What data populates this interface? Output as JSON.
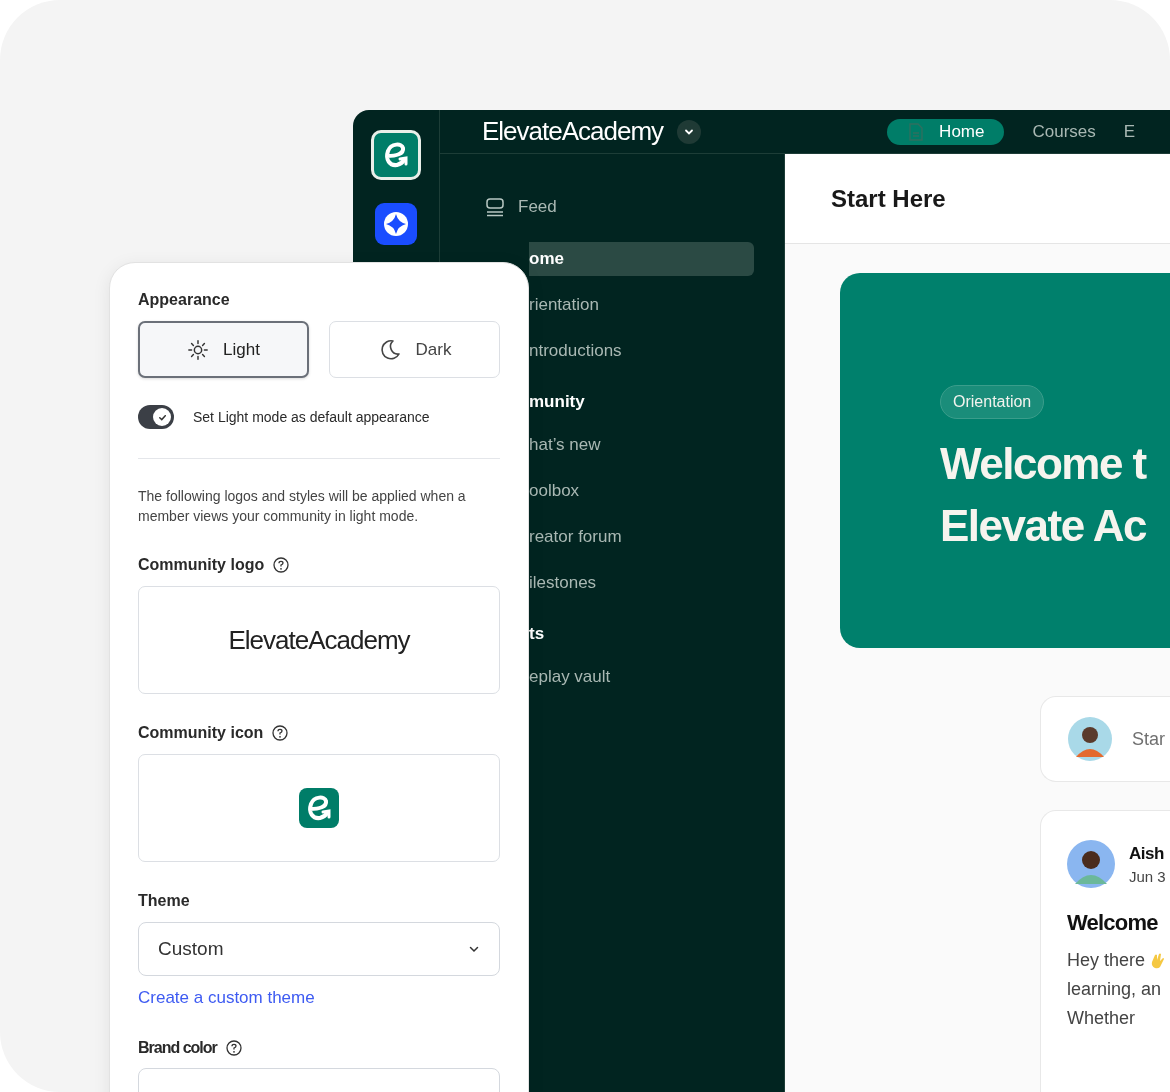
{
  "header": {
    "community_name": "ElevateAcademy",
    "nav": [
      {
        "label": "Home",
        "selected": true
      },
      {
        "label": "Courses",
        "selected": false
      },
      {
        "label": "E",
        "selected": false
      }
    ]
  },
  "sidebar": {
    "items": [
      {
        "label": "Feed",
        "kind": "link",
        "selected": false
      },
      {
        "label": "ome",
        "kind": "link",
        "selected": true
      },
      {
        "label": "rientation",
        "kind": "link",
        "selected": false
      },
      {
        "label": "ntroductions",
        "kind": "link",
        "selected": false
      },
      {
        "label": "munity",
        "kind": "heading"
      },
      {
        "label": "hat’s new",
        "kind": "link",
        "selected": false
      },
      {
        "label": "oolbox",
        "kind": "link",
        "selected": false
      },
      {
        "label": "reator forum",
        "kind": "link",
        "selected": false
      },
      {
        "label": "ilestones",
        "kind": "link",
        "selected": false
      },
      {
        "label": "ts",
        "kind": "heading"
      },
      {
        "label": "eplay vault",
        "kind": "link",
        "selected": false
      }
    ]
  },
  "content": {
    "title": "Start Here",
    "hero": {
      "tag": "Orientation",
      "title_lines": [
        "Welcome t",
        "Elevate Ac"
      ]
    },
    "composer": {
      "placeholder": "Star"
    },
    "post": {
      "author": "Aish",
      "date": "Jun 3",
      "title": "Welcome",
      "body_lines": [
        "Hey there",
        "learning, an",
        "Whether"
      ]
    }
  },
  "settings": {
    "appearance": {
      "label": "Appearance",
      "options": [
        {
          "label": "Light",
          "kind": "light",
          "selected": true
        },
        {
          "label": "Dark",
          "kind": "dark",
          "selected": false
        }
      ],
      "default_toggle": {
        "label": "Set Light mode as default appearance",
        "on": true
      }
    },
    "description": "The following logos and styles will be applied when a member views your community in light mode.",
    "logo": {
      "label": "Community logo",
      "wordmark": "ElevateAcademy"
    },
    "icon": {
      "label": "Community icon"
    },
    "theme": {
      "label": "Theme",
      "value": "Custom",
      "link": "Create a custom theme"
    },
    "brand_color": {
      "label": "Brand color"
    }
  }
}
